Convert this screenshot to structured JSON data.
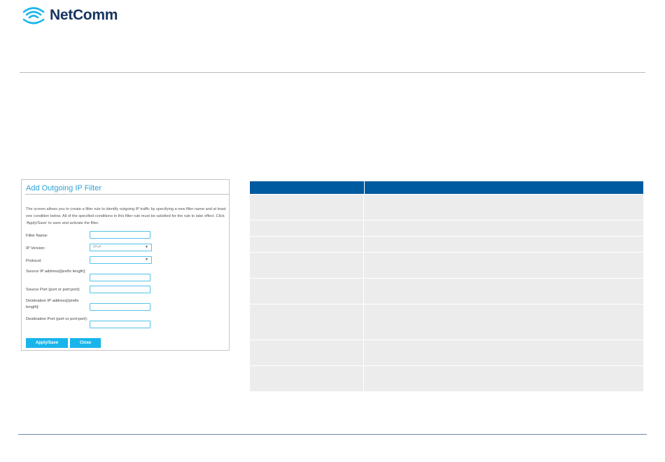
{
  "brand": {
    "name": "NetComm",
    "colors": {
      "brand_navy": "#17345f",
      "accent_blue": "#2aa2d6",
      "button_cyan": "#19b5ea",
      "table_header": "#005aa0",
      "row_grey": "#ececec"
    }
  },
  "dialog": {
    "title": "Add Outgoing IP Filter",
    "description": "The screen allows you to create a filter rule to identify outgoing IP traffic by specifying a new filter name and at least one condition below. All of the specified conditions in this filter rule must be satisfied for the rule to take effect. Click 'Apply/Save' to save and activate the filter.",
    "fields": {
      "filter_name": {
        "label": "Filter Name:",
        "value": ""
      },
      "ip_version": {
        "label": "IP Version:",
        "selected": "IPv4"
      },
      "protocol": {
        "label": "Protocol:",
        "selected": ""
      },
      "source_ip": {
        "label": "Source IP address[/prefix length]:",
        "value": ""
      },
      "source_port": {
        "label": "Source Port (port or port:port):",
        "value": ""
      },
      "destination_ip": {
        "label": "Destination IP address[/prefix length]:",
        "value": ""
      },
      "destination_port": {
        "label": "Destination Port (port or port:port):",
        "value": ""
      }
    },
    "buttons": {
      "apply": "Apply/Save",
      "close": "Close"
    }
  },
  "table": {
    "header": [
      "",
      ""
    ],
    "rows": [
      {
        "item": "",
        "definition": ""
      },
      {
        "item": "",
        "definition": ""
      },
      {
        "item": "",
        "definition": ""
      },
      {
        "item": "",
        "definition": ""
      },
      {
        "item": "",
        "definition": ""
      },
      {
        "item": "",
        "definition": ""
      },
      {
        "item": "",
        "definition": ""
      },
      {
        "item": "",
        "definition": ""
      }
    ]
  }
}
